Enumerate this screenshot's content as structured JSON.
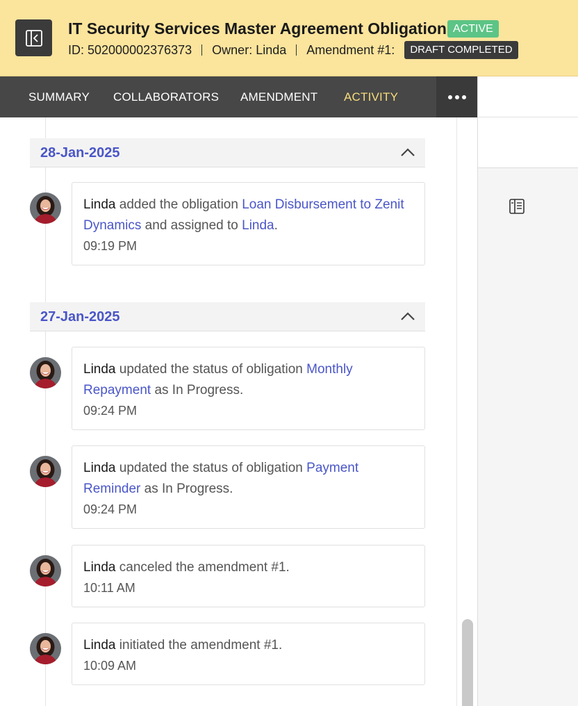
{
  "header": {
    "title": "IT Security Services Master Agreement Obligation",
    "status": "ACTIVE",
    "id_text": "ID: 502000002376373",
    "owner_text": "Owner: Linda",
    "amendment_text": "Amendment #1:",
    "amendment_status": "DRAFT COMPLETED"
  },
  "tabs": [
    {
      "label": "SUMMARY"
    },
    {
      "label": "COLLABORATORS"
    },
    {
      "label": "AMENDMENT"
    },
    {
      "label": "ACTIVITY"
    }
  ],
  "groups": [
    {
      "date": "28-Jan-2025",
      "entries": [
        {
          "user": "Linda",
          "t1": " added the obligation ",
          "link1": "Loan Disbursement to Zenit Dynamics",
          "t2": " and assigned to ",
          "link2": "Linda",
          "t3": ".",
          "time": "09:19 PM"
        }
      ]
    },
    {
      "date": "27-Jan-2025",
      "entries": [
        {
          "user": "Linda",
          "t1": " updated the status of obligation ",
          "link1": "Monthly Repayment",
          "t2": " as In Progress.",
          "time": "09:24 PM"
        },
        {
          "user": "Linda",
          "t1": " updated the status of obligation ",
          "link1": "Payment Reminder",
          "t2": " as In Progress.",
          "time": "09:24 PM"
        },
        {
          "user": "Linda",
          "t1": " canceled the amendment #1.",
          "time": "10:11 AM"
        },
        {
          "user": "Linda",
          "t1": " initiated the amendment #1.",
          "time": "10:09 AM"
        }
      ]
    }
  ],
  "colors": {
    "header_bg": "#fbe49c",
    "active_badge": "#5cc486",
    "tab_bar": "#474747",
    "active_tab": "#f8dc7c",
    "link": "#4a56c8"
  },
  "icons": {
    "back": "panel-collapse-icon",
    "more": "more-horizontal-icon",
    "chevron": "chevron-up-icon",
    "side_panel": "side-panel-icon"
  }
}
